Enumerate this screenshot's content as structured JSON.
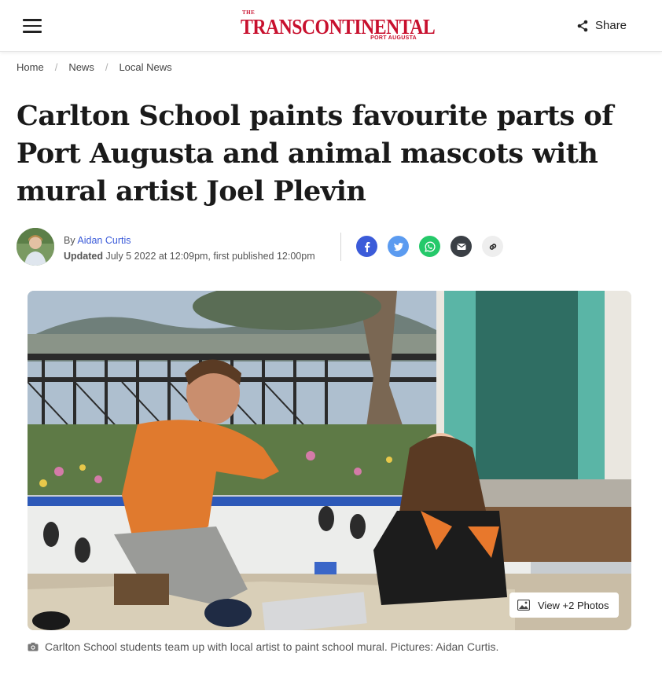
{
  "header": {
    "logo_the": "THE",
    "logo_name": "TRANSCONTINENTAL",
    "logo_sub": "PORT AUGUSTA",
    "share_label": "Share",
    "brand_color": "#c8102e"
  },
  "breadcrumb": {
    "items": [
      "Home",
      "News",
      "Local News"
    ],
    "separator": "/"
  },
  "article": {
    "title": "Carlton School paints favourite parts of Port Augusta and animal mascots with mural artist Joel Plevin",
    "byline_prefix": "By",
    "author": "Aidan Curtis",
    "updated_label": "Updated",
    "updated_text": "July 5 2022 at 12:09pm, first published 12:00pm",
    "author_color": "#3b5bd9"
  },
  "social": [
    {
      "name": "facebook-icon",
      "color": "#3b5bd9"
    },
    {
      "name": "twitter-icon",
      "color": "#5b9bf0"
    },
    {
      "name": "whatsapp-icon",
      "color": "#25c96a"
    },
    {
      "name": "email-icon",
      "color": "#3a3f45"
    },
    {
      "name": "link-icon",
      "color": "#eeeeee"
    }
  ],
  "hero": {
    "view_photos_label": "View +2 Photos"
  },
  "caption": {
    "text": "Carlton School students team up with local artist to paint school mural. Pictures: Aidan Curtis."
  }
}
